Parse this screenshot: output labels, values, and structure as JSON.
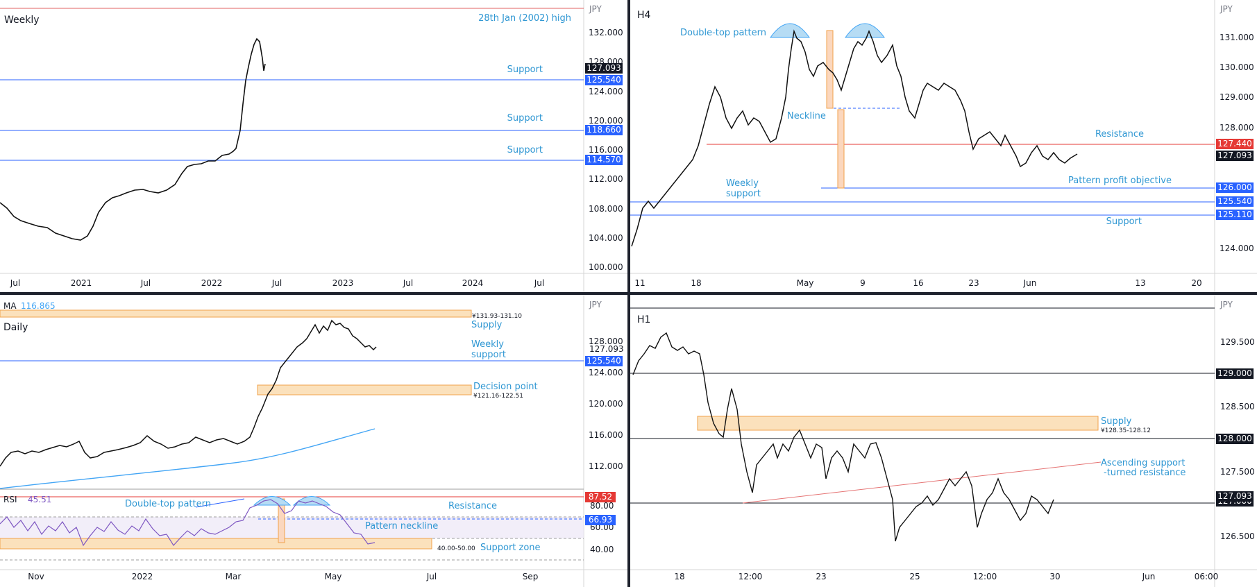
{
  "chart_data": [
    {
      "type": "candlestick",
      "panel": "weekly",
      "title": "Weekly",
      "currency": "JPY",
      "y_ticks": [
        "132.000",
        "128.000",
        "124.000",
        "120.000",
        "116.000",
        "112.000",
        "108.000",
        "104.000",
        "100.000"
      ],
      "x_ticks": [
        "Jul",
        "2021",
        "Jul",
        "2022",
        "Jul",
        "2023",
        "Jul",
        "2024",
        "Jul"
      ],
      "series": [
        {
          "x": [
            "2020-06",
            "2020-09",
            "2020-12",
            "2021-03",
            "2021-06",
            "2021-09",
            "2021-12",
            "2022-02",
            "2022-03",
            "2022-04",
            "2022-05"
          ],
          "values": [
            106.5,
            105.2,
            103.2,
            108.8,
            110.4,
            109.8,
            114.2,
            115.0,
            121.5,
            130.5,
            127.1
          ]
        }
      ],
      "levels": [
        {
          "label": "28th Jan (2002) high",
          "value": 135.2,
          "color": "#e06060"
        },
        {
          "label": "Support",
          "value": 125.54,
          "badge": "125.540"
        },
        {
          "label": "Support",
          "value": 118.66,
          "badge": "118.660"
        },
        {
          "label": "Support",
          "value": 114.57,
          "badge": "114.570"
        }
      ],
      "price": {
        "value": 127.093,
        "badge": "127.093"
      }
    },
    {
      "type": "candlestick",
      "panel": "h4",
      "title": "H4",
      "currency": "JPY",
      "y_ticks": [
        "131.000",
        "130.000",
        "129.000",
        "128.000",
        "127.000",
        "126.000",
        "125.000",
        "124.000"
      ],
      "x_ticks": [
        "11",
        "18",
        "May",
        "9",
        "16",
        "23",
        "Jun",
        "13",
        "20"
      ],
      "series": [
        {
          "x": [
            "Apr 11",
            "Apr 18",
            "Apr 25",
            "May 2",
            "May 9",
            "May 16",
            "May 23",
            "May 27"
          ],
          "values": [
            125.0,
            126.5,
            128.2,
            130.3,
            130.9,
            129.4,
            127.3,
            127.1
          ]
        }
      ],
      "annotations": [
        "Double-top pattern",
        "Neckline",
        "Weekly support",
        "Resistance",
        "Pattern profit objective",
        "Support"
      ],
      "levels": [
        {
          "label": "Resistance",
          "value": 127.44,
          "badge": "127.440",
          "color": "#e53935"
        },
        {
          "label": "Pattern profit objective",
          "value": 126.0,
          "badge": "126.000"
        },
        {
          "label": "Weekly support",
          "value": 125.54,
          "badge": "125.540"
        },
        {
          "label": "Support",
          "value": 125.11,
          "badge": "125.110"
        }
      ],
      "price": {
        "value": 127.093,
        "badge": "127.093"
      }
    },
    {
      "type": "candlestick",
      "panel": "daily",
      "title": "Daily",
      "currency": "JPY",
      "ma": {
        "label": "MA",
        "value": "116.865"
      },
      "y_ticks": [
        "128.000",
        "124.000",
        "120.000",
        "116.000",
        "112.000"
      ],
      "x_ticks": [
        "Nov",
        "2022",
        "Mar",
        "May",
        "Jul",
        "Sep"
      ],
      "series": [
        {
          "x": [
            "2021-10",
            "2021-12",
            "2022-02",
            "2022-03",
            "2022-04",
            "2022-05"
          ],
          "values": [
            113.5,
            114.5,
            115.2,
            121.5,
            129.5,
            127.1
          ]
        }
      ],
      "zones": [
        {
          "label": "Supply",
          "range": "¥131.93-131.10"
        },
        {
          "label": "Decision point",
          "range": "¥121.16-122.51"
        }
      ],
      "annotations": [
        "Weekly support"
      ],
      "levels": [
        {
          "label": "Weekly support",
          "value": 125.54,
          "badge": "125.540"
        }
      ],
      "price": {
        "value": 127.093,
        "badge": "127.093"
      },
      "rsi": {
        "label": "RSI",
        "value": "45.51",
        "y_ticks": [
          "80.00",
          "60.00",
          "40.00"
        ],
        "annotations": [
          "Double-top pattern",
          "Resistance",
          "Pattern neckline",
          "Support zone"
        ],
        "zone_range": "40.00-50.00",
        "badges": [
          "87.52",
          "66.93"
        ]
      }
    },
    {
      "type": "candlestick",
      "panel": "h1",
      "title": "H1",
      "currency": "JPY",
      "y_ticks": [
        "129.500",
        "128.500",
        "127.500",
        "126.500"
      ],
      "x_ticks": [
        "18",
        "12:00",
        "23",
        "25",
        "12:00",
        "30",
        "Jun",
        "06:00"
      ],
      "series": [
        {
          "x": [
            "May 17",
            "May 18",
            "May 19",
            "May 23",
            "May 24",
            "May 25",
            "May 26",
            "May 27"
          ],
          "values": [
            129.6,
            128.9,
            127.2,
            127.6,
            127.0,
            126.6,
            127.2,
            127.1
          ]
        }
      ],
      "zones": [
        {
          "label": "Supply",
          "range": "¥128.35-128.12"
        }
      ],
      "annotations": [
        "Ascending support",
        "-turned resistance"
      ],
      "levels": [
        {
          "label": "",
          "value": 129.0,
          "badge": "129.000"
        },
        {
          "label": "",
          "value": 128.0,
          "badge": "128.000"
        },
        {
          "label": "",
          "value": 127.0,
          "badge": "127.000"
        }
      ],
      "price": {
        "value": 127.093,
        "badge": "127.093"
      }
    }
  ],
  "colors": {
    "blue": "#2962ff",
    "label": "#2f97d3",
    "resistance": "#e53935",
    "zone": "#fbe1bc",
    "zone_border": "#f0a24b",
    "rsi": "#7e57c2",
    "ma": "#42a5f5"
  }
}
